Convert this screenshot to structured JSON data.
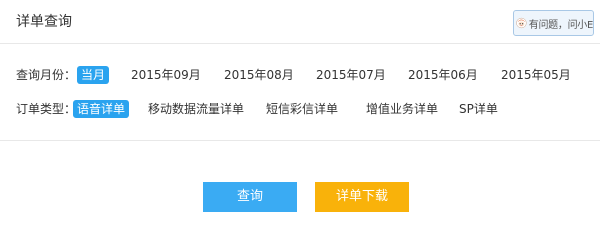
{
  "header": {
    "title": "详单查询",
    "help_text": "有问题，问小E"
  },
  "month_filter": {
    "label": "查询月份：",
    "options": [
      "当月",
      "2015年09月",
      "2015年08月",
      "2015年07月",
      "2015年06月",
      "2015年05月"
    ],
    "selected": "当月"
  },
  "type_filter": {
    "label": "订单类型：",
    "options": [
      "语音详单",
      "移动数据流量详单",
      "短信彩信详单",
      "增值业务详单",
      "SP详单"
    ],
    "selected": "语音详单"
  },
  "actions": {
    "query_label": "查询",
    "download_label": "详单下载"
  },
  "colors": {
    "selected_bg": "#2aa3ef",
    "query_button": "#3aabf3",
    "download_button": "#f9b20a"
  },
  "icons": {
    "help_avatar": "robot-avatar-icon"
  }
}
